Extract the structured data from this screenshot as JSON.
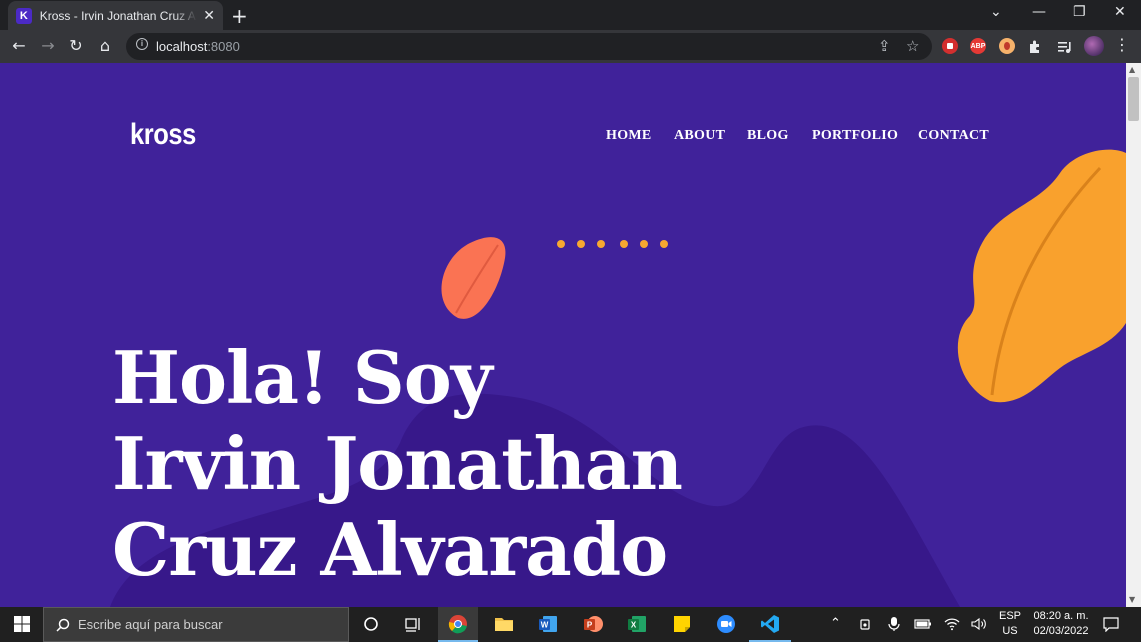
{
  "tab": {
    "favicon_letter": "K",
    "title": "Kross - Irvin Jonathan Cruz Alvarado",
    "close_glyph": "✕",
    "new_tab_glyph": "+"
  },
  "window_controls": {
    "tab_search": "⌄",
    "minimize": "—",
    "restore": "❐",
    "close": "✕"
  },
  "toolbar": {
    "back": "←",
    "forward": "→",
    "reload": "↻",
    "home": "⌂",
    "url_host": "localhost",
    "url_port": ":8080",
    "info_glyph": "i",
    "share_icon": "⇪",
    "star_icon": "☆",
    "ext_abp": "ABP",
    "menu_icon": "⋮"
  },
  "site": {
    "logo": "kross",
    "nav": [
      "HOME",
      "ABOUT",
      "BLOG",
      "PORTFOLIO",
      "CONTACT"
    ],
    "hero_lines": [
      "Hola! Soy",
      "Irvin Jonathan",
      "Cruz Alvarado"
    ],
    "colors": {
      "background": "#40229a",
      "wave": "#37188a",
      "leaf_orange": "#f9a12d",
      "leaf_red": "#fa7353",
      "dots": "#f8a830"
    }
  },
  "taskbar": {
    "search_placeholder": "Escribe aquí para buscar",
    "lang_top": "ESP",
    "lang_bottom": "US",
    "time": "08:20 a. m.",
    "date": "02/03/2022"
  }
}
